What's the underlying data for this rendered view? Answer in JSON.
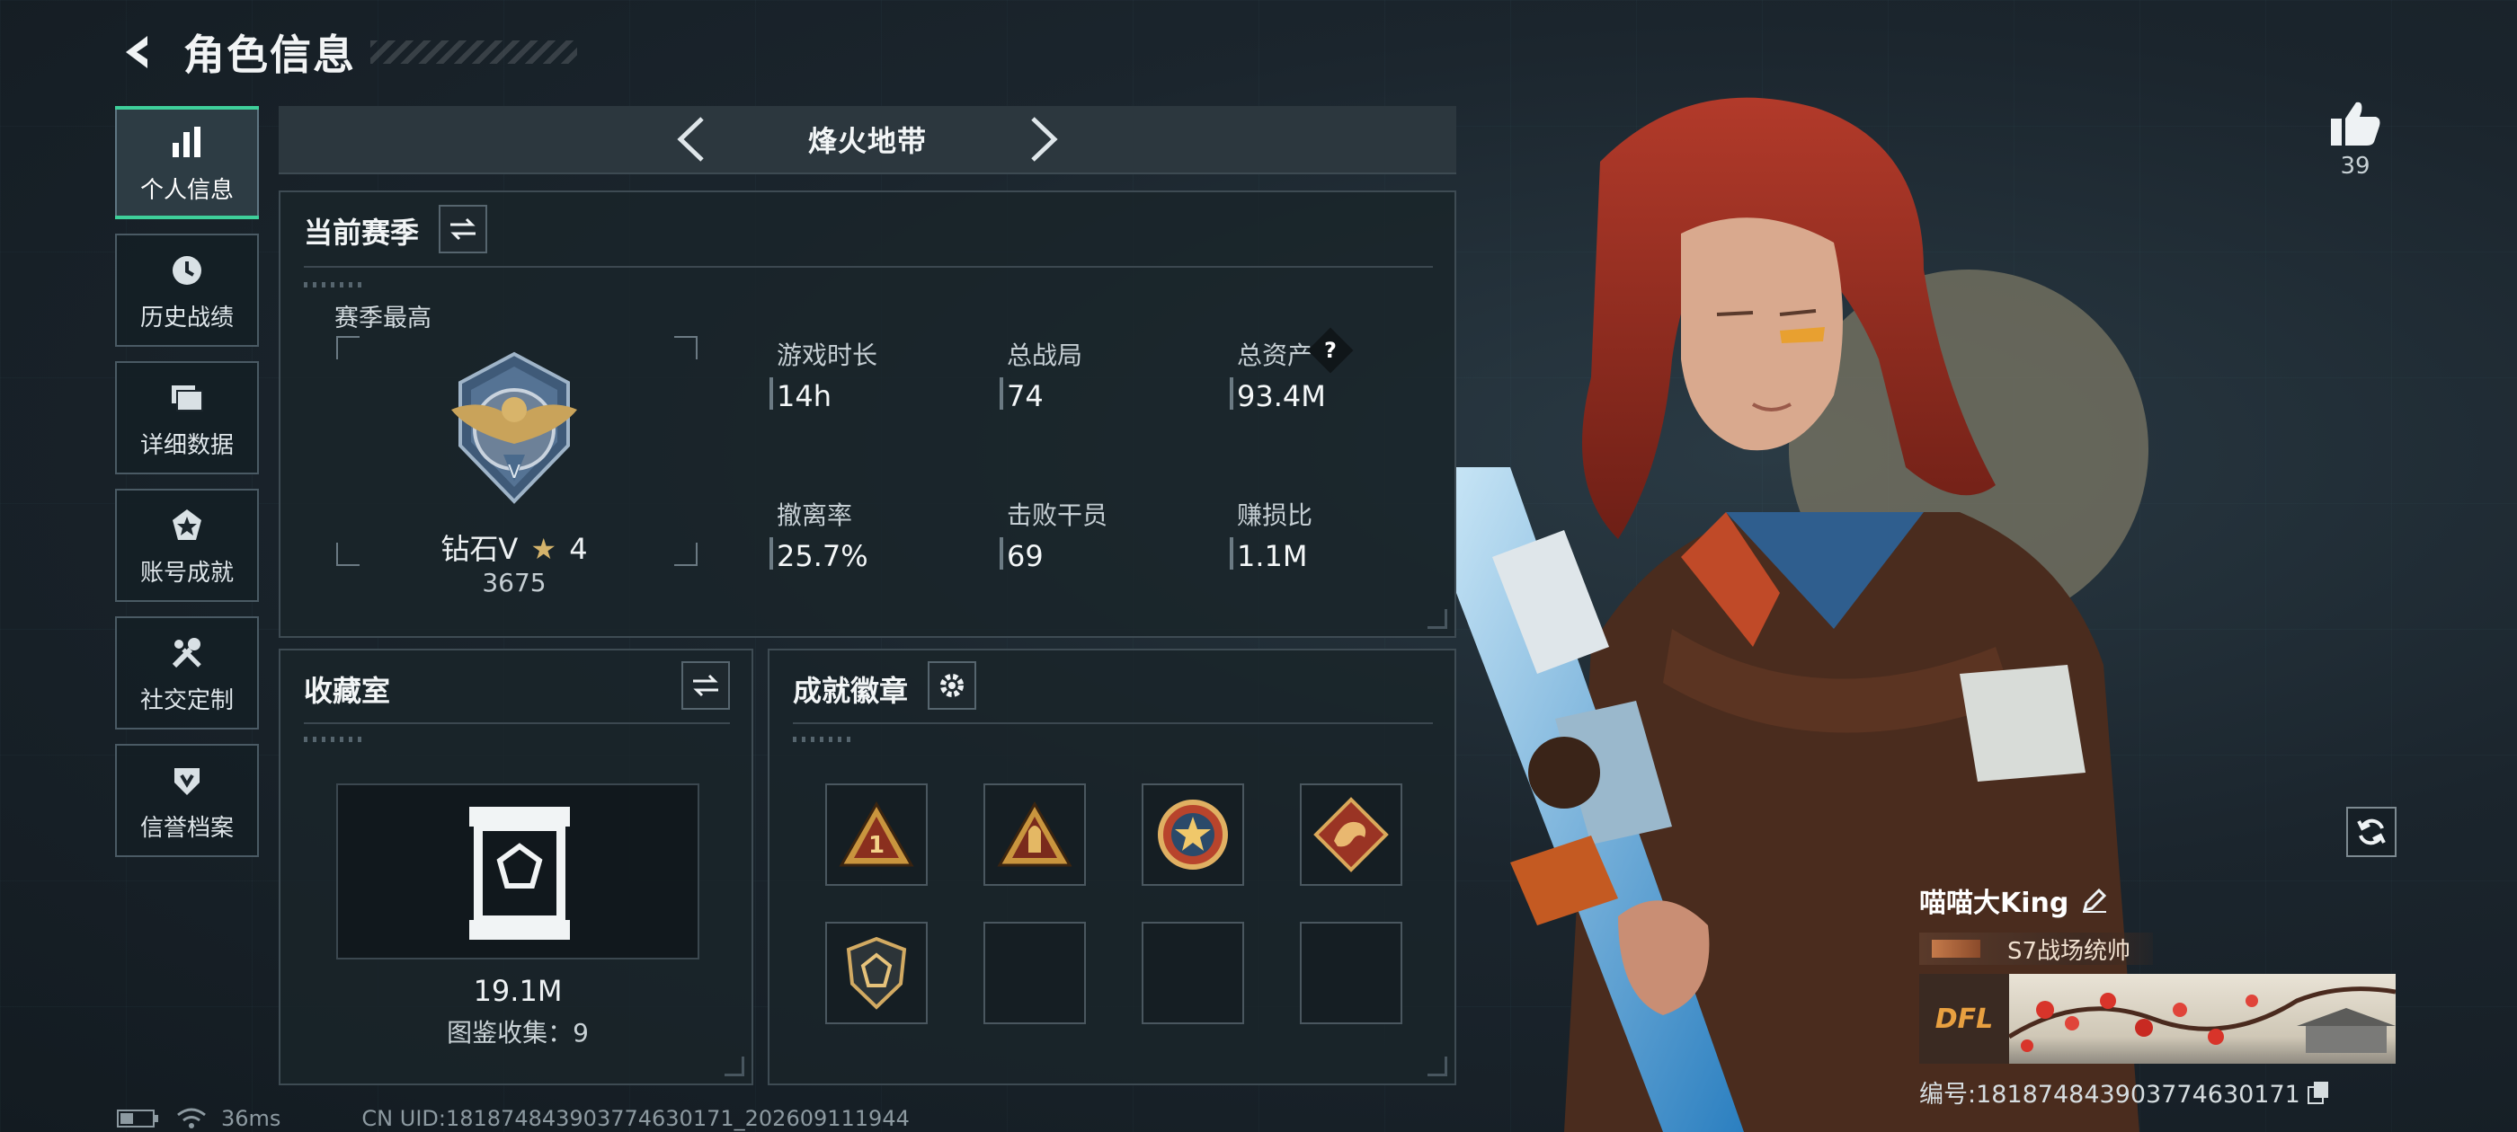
{
  "header": {
    "title": "角色信息"
  },
  "sidebar": {
    "items": [
      {
        "label": "个人信息",
        "icon": "bar-chart-icon",
        "active": true
      },
      {
        "label": "历史战绩",
        "icon": "clock-icon",
        "active": false
      },
      {
        "label": "详细数据",
        "icon": "folder-icon",
        "active": false
      },
      {
        "label": "账号成就",
        "icon": "achievement-icon",
        "active": false
      },
      {
        "label": "社交定制",
        "icon": "tools-icon",
        "active": false
      },
      {
        "label": "信誉档案",
        "icon": "credit-icon",
        "active": false
      }
    ]
  },
  "mode_bar": {
    "title": "烽火地带"
  },
  "season": {
    "title": "当前赛季",
    "best_label": "赛季最高",
    "rank_name": "钻石V",
    "rank_stars": "4",
    "rank_score": "3675",
    "stats": [
      {
        "label": "游戏时长",
        "value": "14h"
      },
      {
        "label": "总战局",
        "value": "74"
      },
      {
        "label": "总资产",
        "value": "93.4M"
      },
      {
        "label": "撤离率",
        "value": "25.7%"
      },
      {
        "label": "击败干员",
        "value": "69"
      },
      {
        "label": "赚损比",
        "value": "1.1M"
      }
    ],
    "help_mark": "?"
  },
  "collection": {
    "title": "收藏室",
    "value": "19.1M",
    "count_text": "图鉴收集：9"
  },
  "badges": {
    "title": "成就徽章",
    "slots": [
      {
        "icon": "rank-one-triangle-badge-icon",
        "empty": false
      },
      {
        "icon": "bullet-triangle-badge-icon",
        "empty": false
      },
      {
        "icon": "star-circle-badge-icon",
        "empty": false
      },
      {
        "icon": "dragon-diamond-badge-icon",
        "empty": false
      },
      {
        "icon": "gem-shield-badge-icon",
        "empty": false
      },
      {
        "icon": "",
        "empty": true
      },
      {
        "icon": "",
        "empty": true
      },
      {
        "icon": "",
        "empty": true
      }
    ]
  },
  "like": {
    "count": "39"
  },
  "player": {
    "name": "喵喵大King",
    "title": "S7战场统帅",
    "banner_logo": "DFL",
    "id_text": "编号:181874843903774630171"
  },
  "status": {
    "ping": "36ms",
    "uid": "CN UID:181874843903774630171_202609111944"
  },
  "colors": {
    "accent": "#3ecf9a",
    "panel_border": "#3e4b53",
    "hair": "#a8382a"
  }
}
